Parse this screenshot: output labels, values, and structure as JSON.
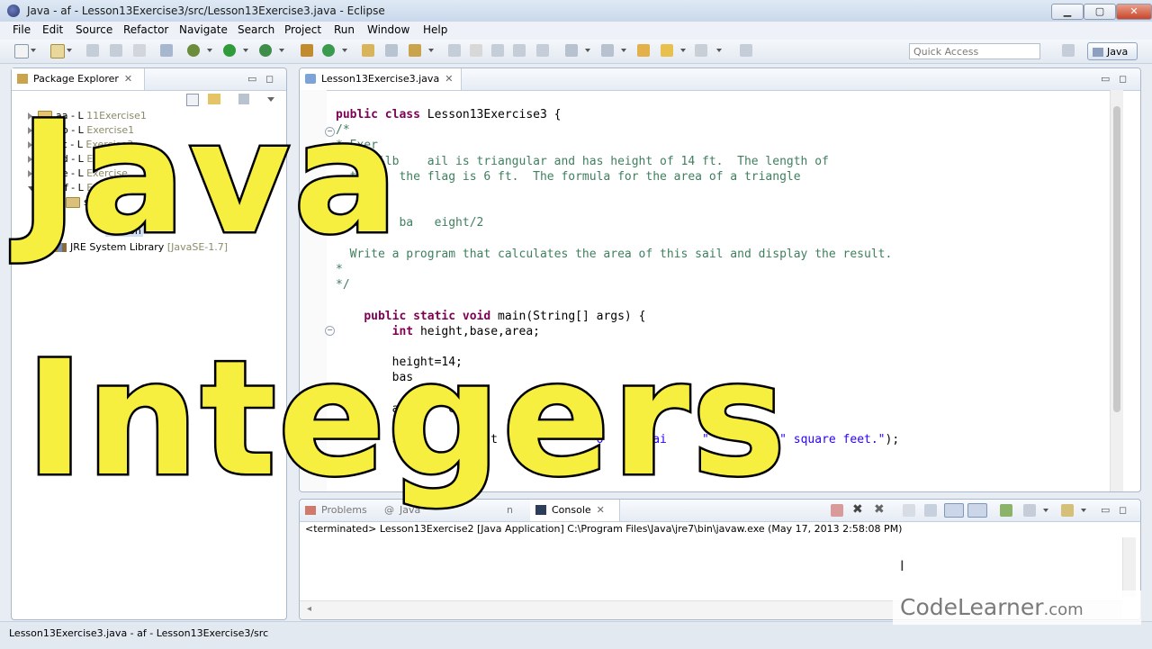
{
  "window": {
    "title": "Java - af - Lesson13Exercise3/src/Lesson13Exercise3.java - Eclipse"
  },
  "menu": [
    "File",
    "Edit",
    "Source",
    "Refactor",
    "Navigate",
    "Search",
    "Project",
    "Run",
    "Window",
    "Help"
  ],
  "toolbar": {
    "quick_access": "Quick Access",
    "perspective": "Java"
  },
  "package_explorer": {
    "title": "Package Explorer",
    "items": [
      {
        "name": "aa - L",
        "decor": "11Exercise1"
      },
      {
        "name": "ab - L",
        "decor": "Exercise1"
      },
      {
        "name": "ac - L",
        "decor": "Exercise3"
      },
      {
        "name": "ad - L",
        "decor": "Exercise"
      },
      {
        "name": "ae - L",
        "decor": "Exercise"
      },
      {
        "name": "af - L",
        "decor": "Exercise"
      },
      {
        "name": "s",
        "decor": ""
      },
      {
        "name": "lt p",
        "decor": ""
      },
      {
        "name": "Lesson",
        "decor": ""
      },
      {
        "name": "JRE System Library",
        "decor": "[JavaSE-1.7]"
      }
    ]
  },
  "editor": {
    "tab": "Lesson13Exercise3.java",
    "lines": [
      {
        "parts": [
          [
            "kw",
            "public "
          ],
          [
            "kw",
            "class "
          ],
          [
            "",
            "Lesson13Exercise3 {"
          ]
        ]
      },
      {
        "parts": [
          [
            "cm",
            "/*"
          ]
        ]
      },
      {
        "parts": [
          [
            "cm",
            "* Exer"
          ]
        ]
      },
      {
        "parts": [
          [
            "cm",
            "  A sailb    ail is triangular and has height of 14 ft.  The length of"
          ]
        ]
      },
      {
        "parts": [
          [
            "cm",
            "  t      the flag is 6 ft.  The formula for the area of a triangle"
          ]
        ]
      },
      {
        "parts": [
          [
            "cm",
            ""
          ]
        ]
      },
      {
        "parts": [
          [
            "cm",
            ""
          ]
        ]
      },
      {
        "parts": [
          [
            "cm",
            "  Ar     ba   eight/2"
          ]
        ]
      },
      {
        "parts": [
          [
            "cm",
            ""
          ]
        ]
      },
      {
        "parts": [
          [
            "cm",
            "  Write a program that calculates the area of this sail and display the result."
          ]
        ]
      },
      {
        "parts": [
          [
            "cm",
            "*"
          ]
        ]
      },
      {
        "parts": [
          [
            "cm",
            "*/"
          ]
        ]
      },
      {
        "parts": [
          [
            "",
            ""
          ]
        ]
      },
      {
        "parts": [
          [
            "",
            "    "
          ],
          [
            "kw",
            "public "
          ],
          [
            "kw",
            "static "
          ],
          [
            "kw",
            "void "
          ],
          [
            "",
            "main(String[] args) {"
          ]
        ]
      },
      {
        "parts": [
          [
            "",
            "        "
          ],
          [
            "kw",
            "int "
          ],
          [
            "",
            "height,base,area;"
          ]
        ]
      },
      {
        "parts": [
          [
            "",
            ""
          ]
        ]
      },
      {
        "parts": [
          [
            "",
            "        height=14;"
          ]
        ]
      },
      {
        "parts": [
          [
            "",
            "        bas"
          ]
        ]
      },
      {
        "parts": [
          [
            "",
            ""
          ]
        ]
      },
      {
        "parts": [
          [
            "",
            "        are     eig"
          ]
        ]
      },
      {
        "parts": [
          [
            "",
            ""
          ]
        ]
      },
      {
        "parts": [
          [
            "",
            "        Sy          int      "
          ],
          [
            "str",
            "\"       o    e sai     \""
          ],
          [
            "",
            "      a + "
          ],
          [
            "str",
            "\" square feet.\""
          ],
          [
            "",
            ");"
          ]
        ]
      }
    ]
  },
  "bottom": {
    "tabs": [
      {
        "label": "Problems",
        "active": false
      },
      {
        "label": "Java",
        "active": false
      },
      {
        "label": "n",
        "active": false
      },
      {
        "label": "Console",
        "active": true
      }
    ],
    "console_line": "<terminated> Lesson13Exercise2 [Java Application] C:\\Program Files\\Java\\jre7\\bin\\javaw.exe (May 17, 2013 2:58:08 PM)"
  },
  "status": {
    "text": "Lesson13Exercise3.java - af - Lesson13Exercise3/src"
  },
  "overlay": {
    "line1": "Java",
    "line2": "Integers"
  },
  "watermark": {
    "code": "CodeLearner",
    "tld": ".com"
  }
}
